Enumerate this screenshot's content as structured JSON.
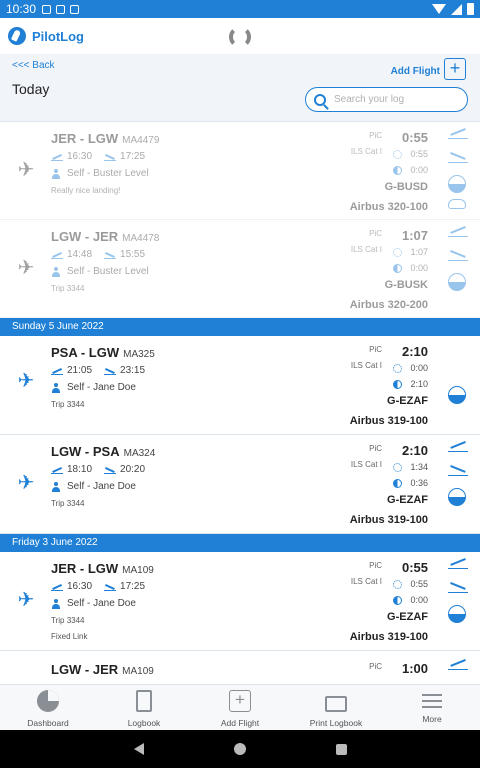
{
  "status_bar": {
    "time": "10:30"
  },
  "app_bar": {
    "title": "PilotLog"
  },
  "header": {
    "back_label": "<<< Back",
    "title": "Today",
    "add_flight_label": "Add Flight",
    "add_flight_icon": "+",
    "search_placeholder": "Search your log"
  },
  "flights_today": [
    {
      "route": "JER - LGW",
      "flight_no": "MA4479",
      "dep": "16:30",
      "arr": "17:25",
      "crew": "Self - Buster Level",
      "note": "Really nice landing!",
      "pic": "PiC",
      "ils": "ILS Cat I",
      "total": "0:55",
      "day": "0:55",
      "night": "0:00",
      "reg": "G-BUSD",
      "aircraft": "Airbus 320-100"
    },
    {
      "route": "LGW - JER",
      "flight_no": "MA4478",
      "dep": "14:48",
      "arr": "15:55",
      "crew": "Self - Buster Level",
      "note": "Trip 3344",
      "pic": "PiC",
      "ils": "ILS Cat I",
      "total": "1:07",
      "day": "1:07",
      "night": "0:00",
      "reg": "G-BUSK",
      "aircraft": "Airbus 320-200"
    }
  ],
  "section_1": {
    "label": "Sunday 5 June 2022"
  },
  "flights_sun": [
    {
      "route": "PSA - LGW",
      "flight_no": "MA325",
      "dep": "21:05",
      "arr": "23:15",
      "crew": "Self - Jane Doe",
      "note": "Trip 3344",
      "pic": "PiC",
      "ils": "ILS Cat I",
      "total": "2:10",
      "day": "0:00",
      "night": "2:10",
      "reg": "G-EZAF",
      "aircraft": "Airbus 319-100"
    },
    {
      "route": "LGW - PSA",
      "flight_no": "MA324",
      "dep": "18:10",
      "arr": "20:20",
      "crew": "Self - Jane Doe",
      "note": "Trip 3344",
      "pic": "PiC",
      "ils": "ILS Cat I",
      "total": "2:10",
      "day": "1:34",
      "night": "0:36",
      "reg": "G-EZAF",
      "aircraft": "Airbus 319-100"
    }
  ],
  "section_2": {
    "label": "Friday 3 June 2022"
  },
  "flights_fri": [
    {
      "route": "JER - LGW",
      "flight_no": "MA109",
      "dep": "16:30",
      "arr": "17:25",
      "crew": "Self - Jane Doe",
      "note": "Trip 3344",
      "note2": "Fixed Link",
      "pic": "PiC",
      "ils": "ILS Cat I",
      "total": "0:55",
      "day": "0:55",
      "night": "0:00",
      "reg": "G-EZAF",
      "aircraft": "Airbus 319-100"
    },
    {
      "route": "LGW - JER",
      "flight_no": "MA109",
      "pic": "PiC",
      "total": "1:00"
    }
  ],
  "bottom_nav": {
    "dashboard": "Dashboard",
    "logbook": "Logbook",
    "add_flight": "Add Flight",
    "add_flight_icon": "+",
    "print_logbook": "Print Logbook",
    "more": "More"
  },
  "icons": {
    "plane": "✈",
    "sync": "sync-icon",
    "accent_color": "#1f80d6"
  }
}
